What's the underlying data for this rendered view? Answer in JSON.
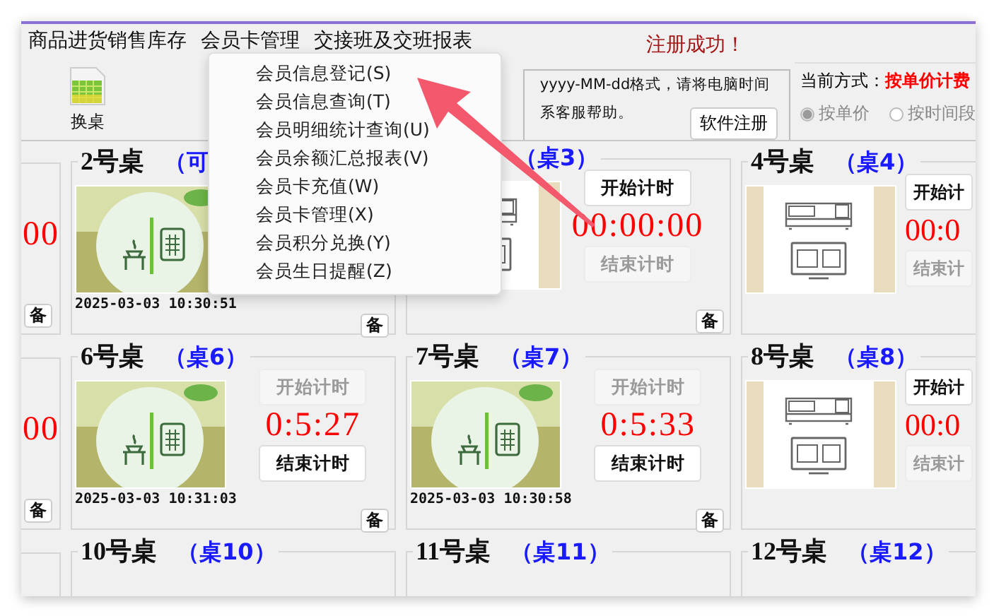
{
  "menu_bar": [
    {
      "label": "商品进货销售库存"
    },
    {
      "label": "会员卡管理"
    },
    {
      "label": "交接班及交班报表"
    }
  ],
  "status_message": "注册成功！",
  "toolbar": [
    {
      "label": "换桌"
    }
  ],
  "notice": {
    "lines": [
      "yyyy-MM-dd格式，请将电脑时间",
      "系客服帮助。"
    ],
    "button": "软件注册"
  },
  "billing": {
    "label": "当前方式：",
    "mode": "按单价计费",
    "options": [
      {
        "label": "按单价",
        "selected": true,
        "disabled": true
      },
      {
        "label": "按时间段",
        "selected": false,
        "disabled": true
      }
    ]
  },
  "rows": [
    {
      "left_card": {
        "timer": "00",
        "note_button": "备"
      },
      "cards": [
        {
          "title": "2号桌",
          "tag": "（可",
          "kind": "tea",
          "timestamp": "2025-03-03 10:30:51",
          "note_button": "备"
        },
        {
          "tag": "（桌3）",
          "kind": "counter",
          "start_button": {
            "label": "开始计时",
            "disabled": false
          },
          "timer": "00:00:00",
          "end_button": {
            "label": "结束计时",
            "disabled": true
          },
          "note_button": "备"
        },
        {
          "title": "4号桌",
          "tag": "（桌4）",
          "kind": "counter",
          "start_button": {
            "label": "开始计",
            "disabled": false
          },
          "timer": "00:0",
          "end_button": {
            "label": "结束计",
            "disabled": true
          }
        }
      ]
    },
    {
      "left_card": {
        "timer": "00",
        "note_button": "备"
      },
      "cards": [
        {
          "title": "6号桌",
          "tag": "（桌6）",
          "kind": "tea",
          "start_button": {
            "label": "开始计时",
            "disabled": true
          },
          "timer": "0:5:27",
          "end_button": {
            "label": "结束计时",
            "disabled": false
          },
          "timestamp": "2025-03-03 10:31:03",
          "note_button": "备"
        },
        {
          "title": "7号桌",
          "tag": "（桌7）",
          "kind": "tea",
          "start_button": {
            "label": "开始计时",
            "disabled": true
          },
          "timer": "0:5:33",
          "end_button": {
            "label": "结束计时",
            "disabled": false
          },
          "timestamp": "2025-03-03 10:30:58",
          "note_button": "备"
        },
        {
          "title": "8号桌",
          "tag": "（桌8）",
          "kind": "counter",
          "start_button": {
            "label": "开始计",
            "disabled": false
          },
          "timer": "00:0",
          "end_button": {
            "label": "结束计",
            "disabled": true
          }
        }
      ]
    },
    {
      "cards": [
        {
          "title": "10号桌",
          "tag": "（桌10）",
          "kind": "empty"
        },
        {
          "title": "11号桌",
          "tag": "（桌11）",
          "kind": "empty"
        },
        {
          "title": "12号桌",
          "tag": "（桌12）",
          "kind": "empty"
        }
      ]
    }
  ],
  "dropdown": {
    "items": [
      {
        "label": "会员信息登记(S)"
      },
      {
        "label": "会员信息查询(T)"
      },
      {
        "label": "会员明细统计查询(U)"
      },
      {
        "label": "会员余额汇总报表(V)"
      },
      {
        "label": "会员卡充值(W)"
      },
      {
        "label": "会员卡管理(X)"
      },
      {
        "label": "会员积分兑换(Y)"
      },
      {
        "label": "会员生日提醒(Z)"
      }
    ]
  }
}
